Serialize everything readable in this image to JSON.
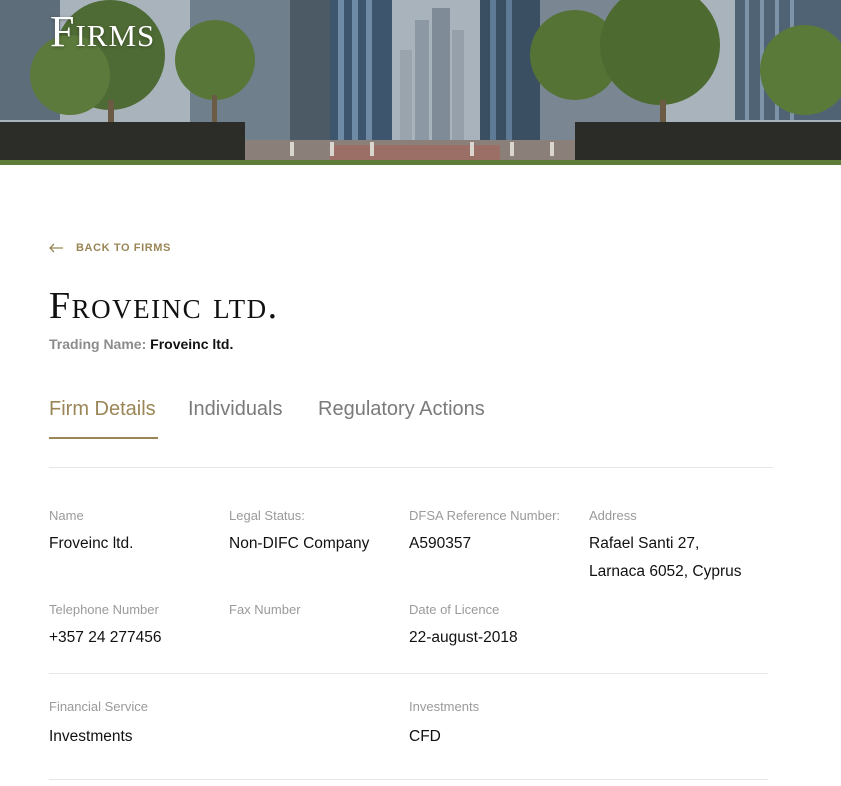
{
  "hero": {
    "title": "Firms"
  },
  "back_link": {
    "label": "BACK TO FIRMS",
    "icon": "arrow-left-icon"
  },
  "firm": {
    "name": "Froveinc ltd.",
    "trading_label": "Trading Name:",
    "trading_value": "Froveinc ltd."
  },
  "tabs": [
    {
      "label": "Firm Details",
      "active": true
    },
    {
      "label": "Individuals",
      "active": false
    },
    {
      "label": "Regulatory Actions",
      "active": false
    }
  ],
  "details": {
    "name": {
      "label": "Name",
      "value": "Froveinc ltd."
    },
    "legal_status": {
      "label": "Legal Status:",
      "value": "Non-DIFC Company"
    },
    "dfsa_ref": {
      "label": "DFSA Reference Number:",
      "value": "A590357"
    },
    "address": {
      "label": "Address",
      "line1": "Rafael Santi 27,",
      "line2": "Larnaca 6052, Cyprus"
    },
    "telephone": {
      "label": "Telephone Number",
      "value": "+357 24 277456"
    },
    "fax": {
      "label": "Fax Number",
      "value": ""
    },
    "licence_date": {
      "label": "Date of Licence",
      "value": "22-august-2018"
    },
    "financial_service": {
      "label": "Financial Service",
      "value": "Investments"
    },
    "investments": {
      "label": "Investments",
      "value": "CFD"
    }
  },
  "colors": {
    "accent": "#9a8556",
    "muted": "#9a9a9a",
    "divider": "#e6e6e6"
  }
}
